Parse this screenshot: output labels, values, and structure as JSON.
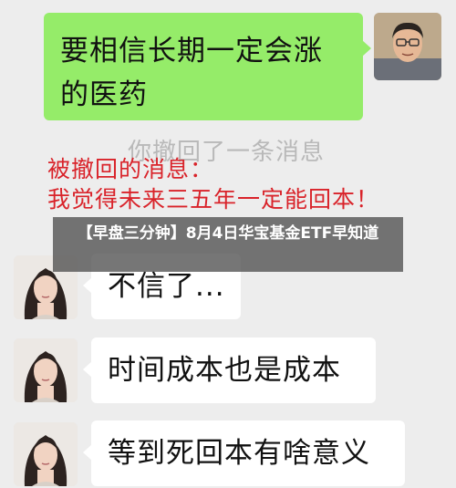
{
  "messages": {
    "sent_1": "要相信长期一定会涨的医药",
    "recall_notice_bg": "你撤回了一条消息",
    "recall_title": "被撤回的消息：",
    "recall_content": "我觉得未来三五年一定能回本！",
    "received_1": "不信了...",
    "received_2": "时间成本也是成本",
    "received_3": "等到死回本有啥意义"
  },
  "overlay": {
    "headline": "【早盘三分钟】8月4日华宝基金ETF早知道"
  },
  "colors": {
    "chat_background": "#ededed",
    "sent_bubble": "#95ec69",
    "received_bubble": "#ffffff",
    "recall_text": "#d9232a",
    "overlay_background": "rgba(80,80,80,0.78)"
  }
}
